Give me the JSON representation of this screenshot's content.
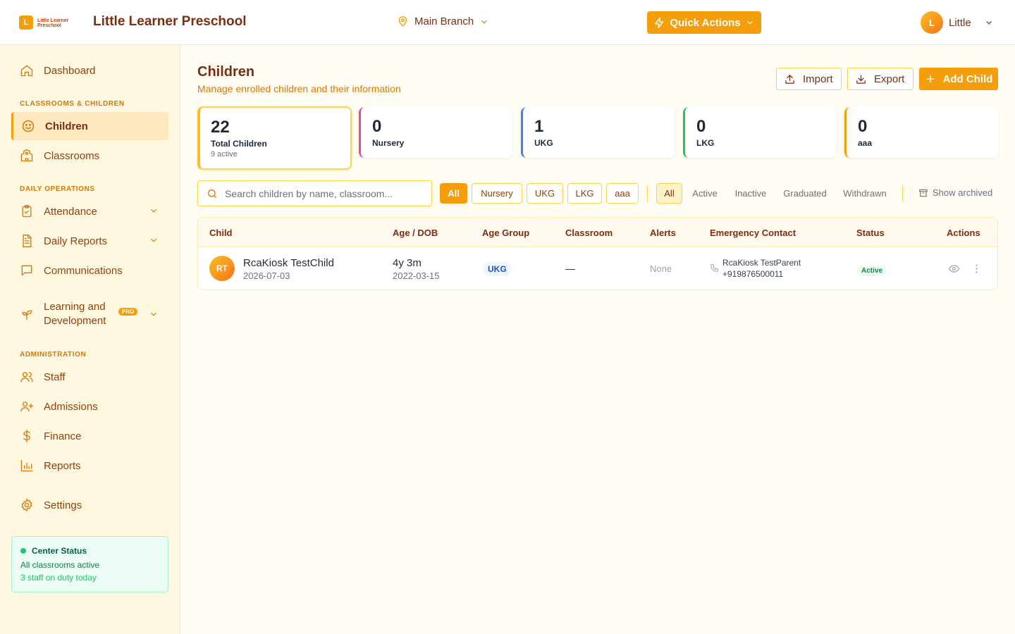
{
  "header": {
    "logo_letter": "L",
    "logo_text": "Little Learner Preschool",
    "app_title": "Little Learner Preschool",
    "branch": "Main Branch",
    "quick_actions": "Quick Actions",
    "user_initial": "L",
    "user_name": "Little"
  },
  "sidebar": {
    "dashboard": "Dashboard",
    "section_classrooms": "CLASSROOMS & CHILDREN",
    "children": "Children",
    "classrooms": "Classrooms",
    "section_daily": "DAILY OPERATIONS",
    "attendance": "Attendance",
    "daily_reports": "Daily Reports",
    "communications": "Communications",
    "learning_line1": "Learning and",
    "learning_line2": "Development",
    "pro_badge": "PRO",
    "section_admin": "ADMINISTRATION",
    "staff": "Staff",
    "admissions": "Admissions",
    "finance": "Finance",
    "reports": "Reports",
    "settings": "Settings",
    "center_status": {
      "title": "Center Status",
      "line1": "All classrooms active",
      "line2": "3 staff on duty today"
    }
  },
  "main": {
    "title": "Children",
    "subtitle": "Manage enrolled children and their information",
    "import": "Import",
    "export": "Export",
    "add_child": "Add Child",
    "stats": [
      {
        "value": "22",
        "label": "Total Children",
        "sub": "9 active",
        "color": "#fbbf24"
      },
      {
        "value": "0",
        "label": "Nursery",
        "color": "#ec4899"
      },
      {
        "value": "1",
        "label": "UKG",
        "color": "#3b82f6"
      },
      {
        "value": "0",
        "label": "LKG",
        "color": "#22c55e"
      },
      {
        "value": "0",
        "label": "aaa",
        "color": "#f59e0b"
      }
    ],
    "search_placeholder": "Search children by name, classroom...",
    "group_filters": [
      "All",
      "Nursery",
      "UKG",
      "LKG",
      "aaa"
    ],
    "status_filters": [
      "All",
      "Active",
      "Inactive",
      "Graduated",
      "Withdrawn"
    ],
    "show_archived": "Show archived",
    "table": {
      "headers": [
        "Child",
        "Age / DOB",
        "Age Group",
        "Classroom",
        "Alerts",
        "Emergency Contact",
        "Status",
        "Actions"
      ],
      "rows": [
        {
          "initials": "RT",
          "name": "RcaKiosk TestChild",
          "date": "2026-07-03",
          "age": "4y 3m",
          "dob": "2022-03-15",
          "group": "UKG",
          "classroom": "—",
          "alerts": "None",
          "contact_name": "RcaKiosk TestParent",
          "contact_phone": "+919876500011",
          "status": "Active"
        }
      ]
    }
  }
}
